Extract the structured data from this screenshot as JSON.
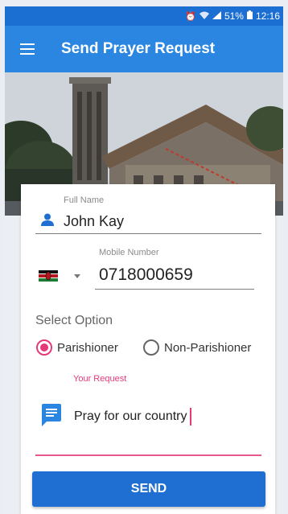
{
  "status_bar": {
    "alarm_icon": "alarm-icon",
    "wifi_icon": "wifi-icon",
    "signal_icon": "signal-icon",
    "battery_percent": "51%",
    "battery_icon": "battery-icon",
    "time": "12:16"
  },
  "app_bar": {
    "menu_icon": "hamburger-menu-icon",
    "title": "Send Prayer Request"
  },
  "form": {
    "full_name": {
      "label": "Full Name",
      "value": "John Kay",
      "icon": "person-icon"
    },
    "mobile": {
      "label": "Mobile Number",
      "country_flag": "kenya-flag-icon",
      "value": "0718000659"
    },
    "select_option": {
      "label": "Select Option",
      "options": [
        "Parishioner",
        "Non-Parishioner"
      ],
      "selected": "Parishioner"
    },
    "request": {
      "label": "Your Request",
      "value": "Pray for our country",
      "icon": "message-icon"
    },
    "send_label": "SEND"
  },
  "colors": {
    "primary": "#2a86e0",
    "status_bar": "#1c6fd2",
    "accent": "#e53979",
    "button": "#1f6fd3"
  }
}
